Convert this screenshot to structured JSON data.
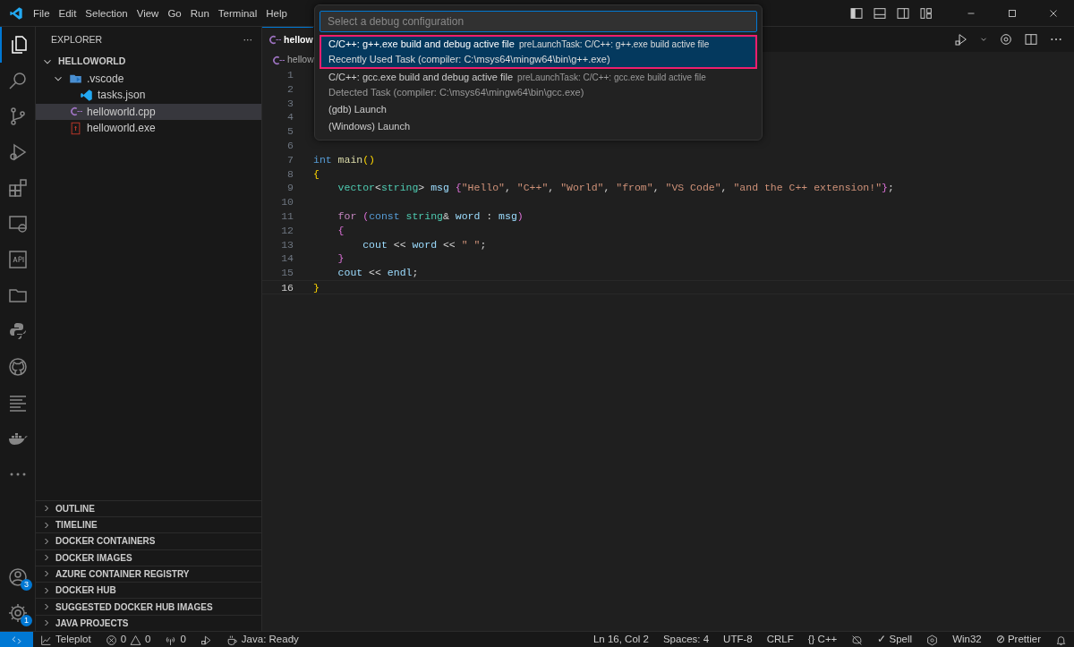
{
  "title_bar": {
    "menu": [
      "File",
      "Edit",
      "Selection",
      "View",
      "Go",
      "Run",
      "Terminal",
      "Help"
    ]
  },
  "activity_bar": {
    "items": [
      {
        "selected": true
      },
      {
        "selected": false
      },
      {
        "selected": false
      },
      {
        "selected": false
      },
      {
        "selected": false
      },
      {
        "selected": false
      },
      {
        "selected": false
      },
      {
        "selected": false
      },
      {
        "selected": false
      },
      {
        "selected": false
      },
      {
        "selected": false
      },
      {
        "selected": false
      },
      {
        "selected": false
      }
    ],
    "bottom": [
      {
        "badge": "3"
      },
      {
        "badge": "1"
      }
    ]
  },
  "sidebar": {
    "title": "EXPLORER",
    "more": "···",
    "tree": [
      {
        "label": "HELLOWORLD",
        "kind": "root",
        "expanded": true,
        "selected": false,
        "children": [
          {
            "label": ".vscode",
            "kind": "folder",
            "expanded": true,
            "selected": false,
            "children": [
              {
                "label": "tasks.json",
                "kind": "json",
                "selected": false
              }
            ]
          },
          {
            "label": "helloworld.cpp",
            "kind": "cpp",
            "selected": true
          },
          {
            "label": "helloworld.exe",
            "kind": "exe",
            "selected": false
          }
        ]
      }
    ],
    "panels": [
      {
        "label": "OUTLINE",
        "expanded": false
      },
      {
        "label": "TIMELINE",
        "expanded": false
      },
      {
        "label": "DOCKER CONTAINERS",
        "expanded": false
      },
      {
        "label": "DOCKER IMAGES",
        "expanded": false
      },
      {
        "label": "AZURE CONTAINER REGISTRY",
        "expanded": false
      },
      {
        "label": "DOCKER HUB",
        "expanded": false
      },
      {
        "label": "SUGGESTED DOCKER HUB IMAGES",
        "expanded": false
      },
      {
        "label": "JAVA PROJECTS",
        "expanded": false
      }
    ]
  },
  "editor": {
    "tabs": [
      {
        "label": "hellow",
        "selected": true
      }
    ],
    "breadcrumb": "hellow",
    "lines": [
      {
        "number": "1",
        "current": false
      },
      {
        "number": "2",
        "current": false
      },
      {
        "number": "3",
        "current": false
      },
      {
        "number": "4",
        "current": false
      },
      {
        "number": "5",
        "current": false
      },
      {
        "number": "6",
        "current": false
      },
      {
        "number": "7",
        "current": false,
        "tokens": [
          {
            "kind": "kw",
            "text": "int "
          },
          {
            "kind": "fn",
            "text": "main"
          },
          {
            "kind": "b1",
            "text": "()"
          }
        ]
      },
      {
        "number": "8",
        "current": false,
        "tokens": [
          {
            "kind": "b1",
            "text": "{"
          }
        ]
      },
      {
        "number": "9",
        "current": false,
        "tokens": [
          {
            "kind": "type",
            "text": "    vector"
          },
          {
            "kind": "plain",
            "text": "<"
          },
          {
            "kind": "type",
            "text": "string"
          },
          {
            "kind": "plain",
            "text": "> "
          },
          {
            "kind": "var",
            "text": "msg "
          },
          {
            "kind": "b2",
            "text": "{"
          },
          {
            "kind": "str",
            "text": "\"Hello\""
          },
          {
            "kind": "plain",
            "text": ", "
          },
          {
            "kind": "str",
            "text": "\"C++\""
          },
          {
            "kind": "plain",
            "text": ", "
          },
          {
            "kind": "str",
            "text": "\"World\""
          },
          {
            "kind": "plain",
            "text": ", "
          },
          {
            "kind": "str",
            "text": "\"from\""
          },
          {
            "kind": "plain",
            "text": ", "
          },
          {
            "kind": "str",
            "text": "\"VS Code\""
          },
          {
            "kind": "plain",
            "text": ", "
          },
          {
            "kind": "str",
            "text": "\"and the C++ extension!\""
          },
          {
            "kind": "b2",
            "text": "}"
          },
          {
            "kind": "plain",
            "text": ";"
          }
        ]
      },
      {
        "number": "10",
        "current": false
      },
      {
        "number": "11",
        "current": false,
        "tokens": [
          {
            "kind": "ctrl",
            "text": "    for "
          },
          {
            "kind": "b2",
            "text": "("
          },
          {
            "kind": "kw",
            "text": "const "
          },
          {
            "kind": "type",
            "text": "string"
          },
          {
            "kind": "plain",
            "text": "& "
          },
          {
            "kind": "var",
            "text": "word"
          },
          {
            "kind": "plain",
            "text": " : "
          },
          {
            "kind": "var",
            "text": "msg"
          },
          {
            "kind": "b2",
            "text": ")"
          }
        ]
      },
      {
        "number": "12",
        "current": false,
        "tokens": [
          {
            "kind": "b2",
            "text": "    {"
          }
        ]
      },
      {
        "number": "13",
        "current": false,
        "tokens": [
          {
            "kind": "var",
            "text": "        cout"
          },
          {
            "kind": "plain",
            "text": " << "
          },
          {
            "kind": "var",
            "text": "word"
          },
          {
            "kind": "plain",
            "text": " << "
          },
          {
            "kind": "str",
            "text": "\" \""
          },
          {
            "kind": "plain",
            "text": ";"
          }
        ]
      },
      {
        "number": "14",
        "current": false,
        "tokens": [
          {
            "kind": "b2",
            "text": "    }"
          }
        ]
      },
      {
        "number": "15",
        "current": false,
        "tokens": [
          {
            "kind": "var",
            "text": "    cout"
          },
          {
            "kind": "plain",
            "text": " << "
          },
          {
            "kind": "var",
            "text": "endl"
          },
          {
            "kind": "plain",
            "text": ";"
          }
        ]
      },
      {
        "number": "16",
        "current": true,
        "tokens": [
          {
            "kind": "b1",
            "text": "}"
          }
        ]
      }
    ]
  },
  "quick_pick": {
    "placeholder": "Select a debug configuration",
    "items": [
      {
        "label": "C/C++: g++.exe build and debug active file",
        "description": "preLaunchTask: C/C++: g++.exe build active file",
        "detail": "Recently Used Task (compiler: C:\\msys64\\mingw64\\bin\\g++.exe)",
        "selected": true
      },
      {
        "label": "C/C++: gcc.exe build and debug active file",
        "description": "preLaunchTask: C/C++: gcc.exe build active file",
        "detail": "Detected Task (compiler: C:\\msys64\\mingw64\\bin\\gcc.exe)",
        "selected": false
      },
      {
        "label": "(gdb) Launch",
        "selected": false
      },
      {
        "label": "(Windows) Launch",
        "selected": false
      }
    ]
  },
  "status_bar": {
    "left": [
      {
        "kind": "remote"
      },
      {
        "kind": "teleplot",
        "text": "Teleplot"
      },
      {
        "kind": "problems",
        "errors": "0",
        "warnings": "0"
      },
      {
        "kind": "ports",
        "text": "0"
      },
      {
        "kind": "debug"
      },
      {
        "kind": "java",
        "text": "Java: Ready"
      }
    ],
    "right": [
      {
        "kind": "text",
        "text": "Ln 16, Col 2"
      },
      {
        "kind": "text",
        "text": "Spaces: 4"
      },
      {
        "kind": "text",
        "text": "UTF-8"
      },
      {
        "kind": "text",
        "text": "CRLF"
      },
      {
        "kind": "lang",
        "icon": "{}",
        "text": "C++"
      },
      {
        "kind": "copilot"
      },
      {
        "kind": "spell",
        "icon": "✓",
        "text": "Spell"
      },
      {
        "kind": "hex"
      },
      {
        "kind": "text",
        "text": "Win32"
      },
      {
        "kind": "prettier",
        "icon": "⊘",
        "text": "Prettier"
      },
      {
        "kind": "bell"
      }
    ]
  }
}
